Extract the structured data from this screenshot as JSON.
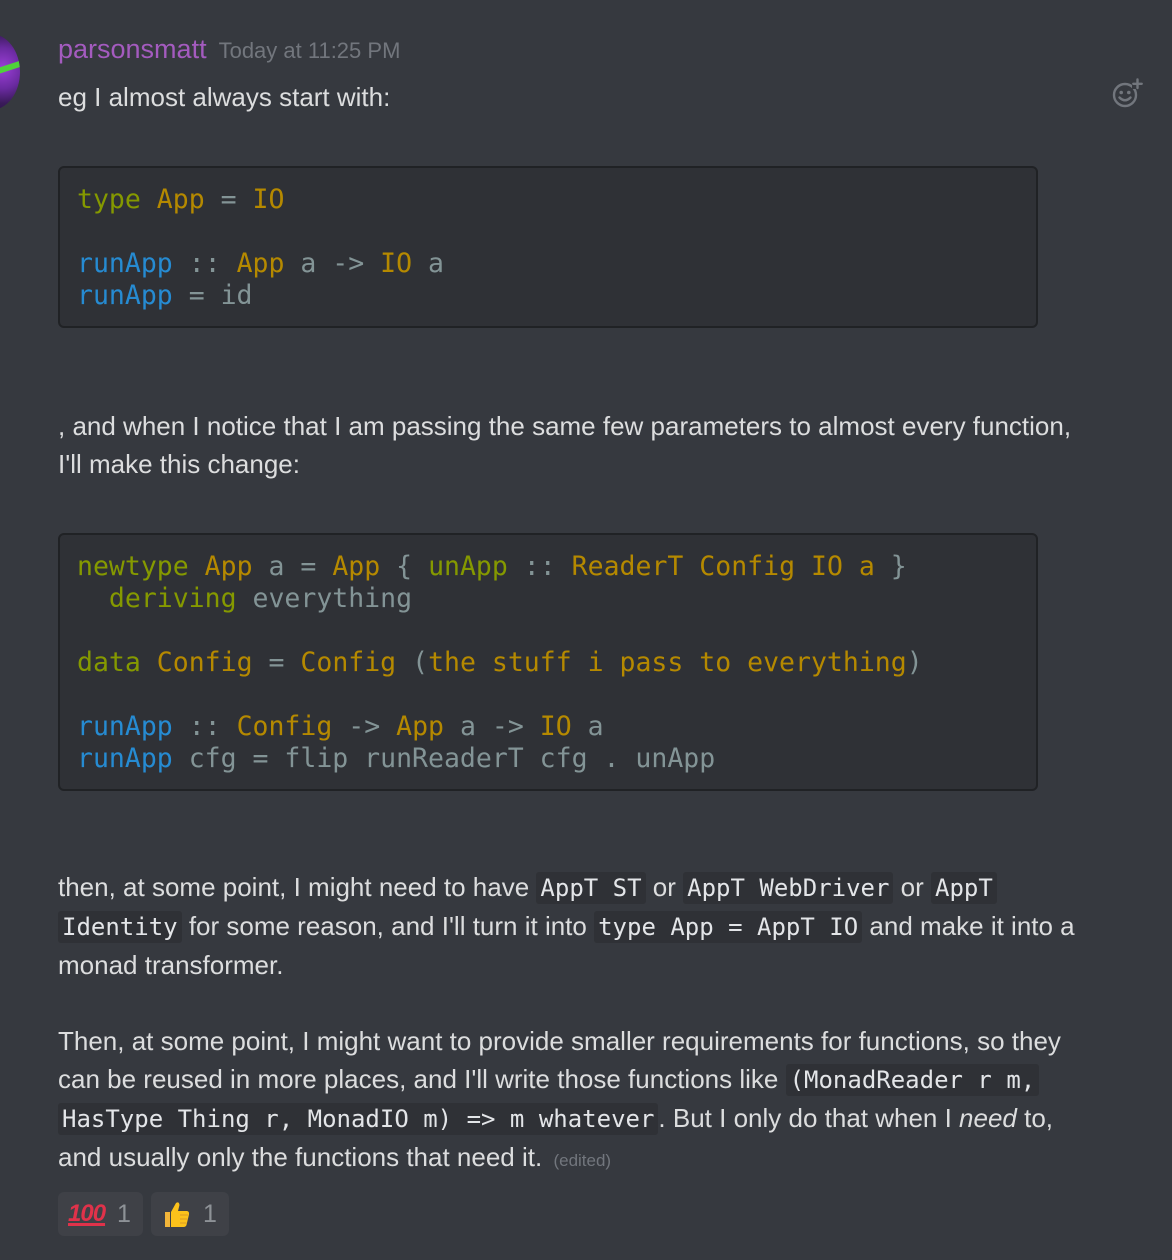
{
  "message": {
    "username": "parsonsmatt",
    "timestamp": "Today at 11:25 PM",
    "intro": "eg I almost always start with:",
    "para1_line1": ", and when I notice that I am passing the same few parameters to almost every function,",
    "para1_line2": "I'll make this change:",
    "para2": {
      "t1": "then, at some point, I might need to have ",
      "c1": "AppT ST",
      "t2": " or ",
      "c2": "AppT WebDriver",
      "t3": " or ",
      "c3a": "AppT ",
      "c3b": "Identity",
      "t4": " for some reason, and I'll turn it into ",
      "c4": "type App = AppT IO",
      "t5": " and make it into a",
      "t6": "monad transformer."
    },
    "para3": {
      "line1": "Then, at some point, I might want to provide smaller requirements for functions, so they",
      "t1": "can be reused in more places, and I'll write those functions like ",
      "c1a": "(MonadReader r m,",
      "c1b": "HasType Thing r, MonadIO m) => m whatever",
      "t2": ". But I only do that when I ",
      "em": "need",
      "t3": " to,",
      "t4": "and usually only the functions that need it.",
      "edited": "(edited)"
    }
  },
  "code1": {
    "l1": {
      "a": "type",
      "b": " ",
      "c": "App",
      "d": " = ",
      "e": "IO"
    },
    "l3": {
      "a": "runApp",
      "b": " :: ",
      "c": "App",
      "d": " a -> ",
      "e": "IO",
      "f": " a"
    },
    "l4": {
      "a": "runApp",
      "b": " = id"
    }
  },
  "code2": {
    "l1": {
      "a": "newtype",
      "b": " ",
      "c": "App",
      "d": " a = ",
      "e": "App",
      "f": " { ",
      "g": "unApp",
      "h": " :: ",
      "i": "ReaderT Config IO a",
      "j": " }"
    },
    "l2": {
      "a": "  deriving",
      "b": " everything"
    },
    "l4": {
      "a": "data",
      "b": " ",
      "c": "Config",
      "d": " = ",
      "e": "Config",
      "f": " (",
      "g": "the stuff i pass to everything",
      "h": ")"
    },
    "l6": {
      "a": "runApp",
      "b": " :: ",
      "c": "Config",
      "d": " -> ",
      "e": "App",
      "f": " a -> ",
      "g": "IO",
      "h": " a"
    },
    "l7": {
      "a": "runApp",
      "b": " cfg = flip runReaderT cfg . unApp"
    }
  },
  "reactions": [
    {
      "emoji": "100-icon",
      "count": "1"
    },
    {
      "emoji": "thumbs-up-icon",
      "count": "1"
    }
  ],
  "reaction_labels": {
    "r100": "100"
  },
  "colors": {
    "background": "#36393f",
    "username": "#a45bbf",
    "code_bg": "#2f3136",
    "keyword": "#859900",
    "type": "#b58900",
    "function": "#268bd2"
  }
}
